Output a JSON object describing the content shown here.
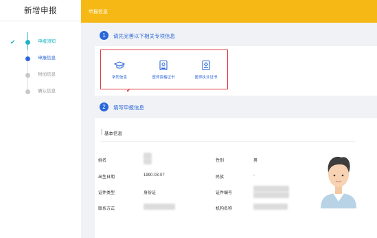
{
  "sidebar": {
    "title": "新增申报",
    "steps": [
      {
        "label": "申报须知",
        "state": "done"
      },
      {
        "label": "申报信息",
        "state": "current"
      },
      {
        "label": "附加信息",
        "state": "pending"
      },
      {
        "label": "确认信息",
        "state": "pending"
      }
    ]
  },
  "header": {
    "title": "申报信息"
  },
  "section1": {
    "number": "1",
    "title": "请先完善以下相关专项信息"
  },
  "certs": [
    {
      "label": "学历信息",
      "icon": "graduation-cap-icon"
    },
    {
      "label": "医师资格证书",
      "icon": "certificate-icon"
    },
    {
      "label": "医师执业证书",
      "icon": "license-icon"
    }
  ],
  "section2": {
    "number": "2",
    "title": "填写申报信息"
  },
  "basic_info": {
    "title": "基本信息",
    "fields": {
      "name_label": "姓名",
      "gender_label": "性别",
      "gender_value": "男",
      "birth_label": "出生日期",
      "birth_value": "1990-03-07",
      "ethnicity_label": "民族",
      "ethnicity_value": "-",
      "id_type_label": "证件类型",
      "id_type_value": "身份证",
      "id_no_label": "证件编号",
      "contact_label": "联系方式",
      "org_label": "机构名称"
    }
  },
  "colors": {
    "header": "#f5b814",
    "accent_blue": "#2b66d9",
    "accent_teal": "#1fb3c5",
    "highlight_red": "#e0363b"
  }
}
